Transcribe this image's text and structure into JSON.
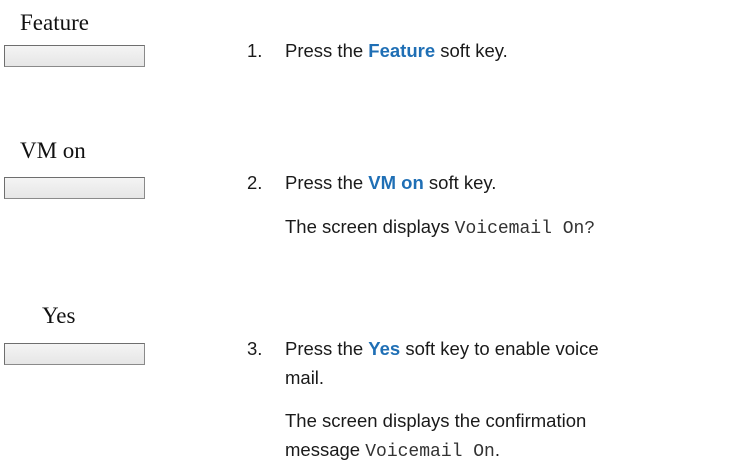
{
  "softkeys": [
    {
      "label": "Feature"
    },
    {
      "label": "VM on"
    },
    {
      "label": "Yes"
    }
  ],
  "steps": [
    {
      "num": "1.",
      "pre": "Press the ",
      "key": "Feature",
      "post": " soft key."
    },
    {
      "num": "2.",
      "pre": "Press the ",
      "key": "VM on",
      "post": " soft key."
    },
    {
      "num": "3.",
      "pre": "Press the ",
      "key": "Yes",
      "post": " soft key to enable voice",
      "cont": "mail."
    }
  ],
  "notes": [
    {
      "text": "The screen displays ",
      "code": "Voicemail On?"
    },
    {
      "line1": "The screen displays the confirmation",
      "line2_pre": "message ",
      "code": "Voicemail On",
      "line2_post": "."
    }
  ],
  "colors": {
    "key_highlight": "#1f6fb5"
  }
}
